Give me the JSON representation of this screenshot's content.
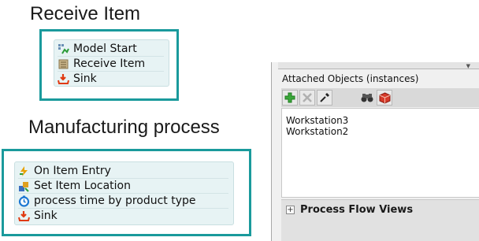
{
  "receive_section": {
    "title": "Receive Item",
    "items": [
      {
        "label": "Model Start",
        "icon": "model-start-icon"
      },
      {
        "label": "Receive Item",
        "icon": "receive-item-icon"
      },
      {
        "label": "Sink",
        "icon": "sink-icon"
      }
    ]
  },
  "manufacturing_section": {
    "title": "Manufacturing process",
    "items": [
      {
        "label": "On Item Entry",
        "icon": "item-entry-icon"
      },
      {
        "label": "Set Item Location",
        "icon": "set-location-icon"
      },
      {
        "label": " process time by product type",
        "icon": "clock-icon"
      },
      {
        "label": "Sink",
        "icon": "sink-icon"
      }
    ]
  },
  "panel": {
    "label": "Attached Objects (instances)",
    "list_items": [
      "Workstation3",
      "Workstation2"
    ],
    "section_title": "Process Flow Views",
    "expander": "+"
  },
  "colors": {
    "frame_border": "#1a9a9c",
    "card_bg": "#e7f3f4",
    "panel_bg": "#f0f0f0"
  }
}
